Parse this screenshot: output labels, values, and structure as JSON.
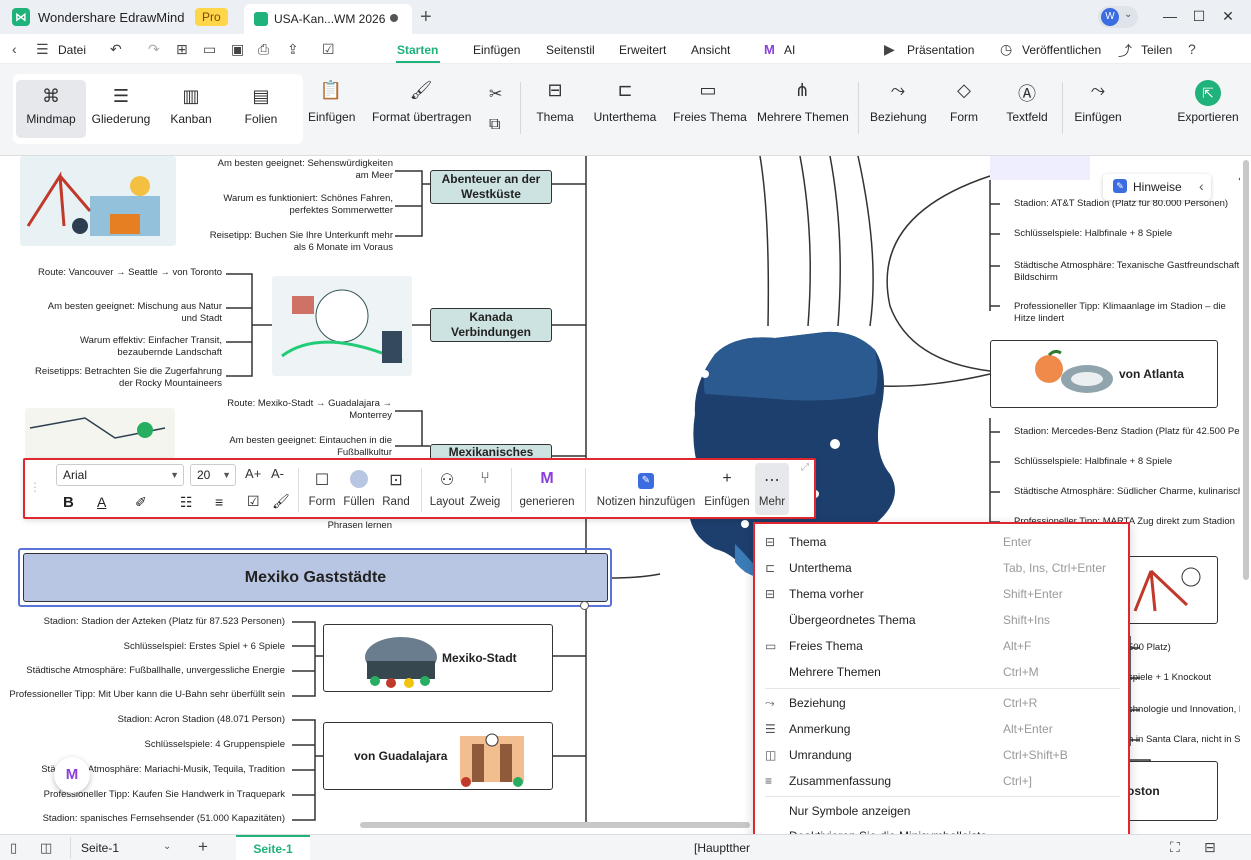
{
  "titlebar": {
    "app_name": "Wondershare EdrawMind",
    "pro_badge": "Pro",
    "doc_tab_title": "USA-Kan...WM 2026",
    "new_tab": "+",
    "avatar_initial": "W"
  },
  "menubar": {
    "file_label": "Datei",
    "tabs": [
      "Starten",
      "Einfügen",
      "Seitenstil",
      "Erweitert",
      "Ansicht",
      "AI"
    ],
    "presentation": "Präsentation",
    "publish": "Veröffentlichen",
    "share": "Teilen"
  },
  "ribbon": {
    "views": [
      "Mindmap",
      "Gliederung",
      "Kanban",
      "Folien"
    ],
    "insert1": "Einfügen",
    "format_painter": "Format übertragen",
    "theme": "Thema",
    "subtheme": "Unterthema",
    "free_theme": "Freies Thema",
    "multi_themes": "Mehrere Themen",
    "relation": "Beziehung",
    "shape": "Form",
    "textfield": "Textfeld",
    "insert2": "Einfügen",
    "export": "Exportieren"
  },
  "hints_panel": {
    "label": "Hinweise"
  },
  "mindmap": {
    "westcoast": {
      "title": "Abenteuer an der Westküste",
      "details": [
        "Am besten geeignet: Sehenswürdigkeiten am Meer",
        "Warum es funktioniert: Schönes Fahren, perfektes Sommerwetter",
        "Reisetipp: Buchen Sie Ihre Unterkunft mehr als 6 Monate im Voraus"
      ]
    },
    "canada": {
      "title": "Kanada Verbindungen",
      "details": [
        "Route: Vancouver → Seattle → von Toronto",
        "Am besten geeignet: Mischung aus Natur und Stadt",
        "Warum effektiv: Einfacher Transit, bezaubernde Landschaft",
        "Reisetipps: Betrachten Sie die Zugerfahrung der Rocky Mountaineers"
      ]
    },
    "mexico_trip": {
      "title": "Mexikanisches",
      "details": [
        "Route: Mexiko-Stadt → Guadalajara → Monterrey",
        "Am besten geeignet: Eintauchen in die Fußballkultur",
        "Phrasen lernen"
      ]
    },
    "main_topic": "Mexiko Gaststädte",
    "mexico_city": {
      "title": "Mexiko-Stadt",
      "details": [
        "Stadion: Stadion der Azteken (Platz für 87.523 Personen)",
        "Schlüsselspiel: Erstes Spiel + 6 Spiele",
        "Städtische Atmosphäre: Fußballhalle, unvergessliche Energie",
        "Professioneller Tipp: Mit Uber kann die U-Bahn sehr überfüllt sein"
      ]
    },
    "guadalajara": {
      "title": "von Guadalajara",
      "details": [
        "Stadion: Acron Stadion (48.071 Person)",
        "Schlüsselspiele: 4 Gruppenspiele",
        "Städtische Atmosphäre: Mariachi-Musik, Tequila, Tradition",
        "Professioneller Tipp: Kaufen Sie Handwerk in Traquepark",
        "Stadion: spanisches Fernsehsender (51.000 Kapazitäten)"
      ]
    },
    "dallas": {
      "details": [
        "Stadion: AT&T Stadion (Platz für 80.000 Personen)",
        "Schlüsselspiele: Halbfinale + 8 Spiele",
        "Städtische Atmosphäre: Texanische Gastfreundschaft, Bildschirm",
        "Professioneller Tipp: Klimaanlage im Stadion – die Hitze lindert"
      ]
    },
    "atlanta": {
      "title": "von Atlanta",
      "details": [
        "Stadion: Mercedes-Benz Stadion (Platz für 42.500 Personen)",
        "Schlüsselspiele: Halbfinale + 8 Spiele",
        "Städtische Atmosphäre: Südlicher Charme, kulinarische Szene",
        "Professioneller Tipp: MARTA Zug direkt zum Stadion"
      ]
    },
    "sf": {
      "details": [
        "500 Platz)",
        "spiele + 1 Knockout",
        "chnologie und Innovation, M",
        "n in Santa Clara, nicht in S"
      ]
    },
    "boston": {
      "title": "oston"
    }
  },
  "minitoolbar": {
    "font": "Arial",
    "size": "20",
    "grow": "A+",
    "shrink": "A-",
    "bold": "B",
    "buttons": [
      "Form",
      "Füllen",
      "Rand",
      "Layout",
      "Zweig",
      "generieren",
      "Notizen hinzufügen",
      "Einfügen",
      "Mehr"
    ]
  },
  "contextmenu": {
    "items": [
      {
        "label": "Thema",
        "shortcut": "Enter"
      },
      {
        "label": "Unterthema",
        "shortcut": "Tab, Ins, Ctrl+Enter"
      },
      {
        "label": "Thema vorher",
        "shortcut": "Shift+Enter"
      },
      {
        "label": "Übergeordnetes Thema",
        "shortcut": "Shift+Ins"
      },
      {
        "label": "Freies Thema",
        "shortcut": "Alt+F"
      },
      {
        "label": "Mehrere Themen",
        "shortcut": "Ctrl+M"
      },
      {
        "label": "Beziehung",
        "shortcut": "Ctrl+R"
      },
      {
        "label": "Anmerkung",
        "shortcut": "Alt+Enter"
      },
      {
        "label": "Umrandung",
        "shortcut": "Ctrl+Shift+B"
      },
      {
        "label": "Zusammenfassung",
        "shortcut": "Ctrl+]"
      },
      {
        "label": "Nur Symbole anzeigen",
        "shortcut": ""
      },
      {
        "label": "Deaktivieren Sie die Minisymbolleiste",
        "shortcut": ""
      }
    ]
  },
  "statusbar": {
    "page_select": "Seite-1",
    "page_tab": "Seite-1",
    "breadcrumb": "[Hauptther"
  },
  "colors": {
    "accent": "#1fb27a",
    "highlight": "#e0262f",
    "topic_fill": "#cde3e1",
    "main_topic_fill": "#b9c6e3",
    "map_fill": "#1d3f6e"
  }
}
